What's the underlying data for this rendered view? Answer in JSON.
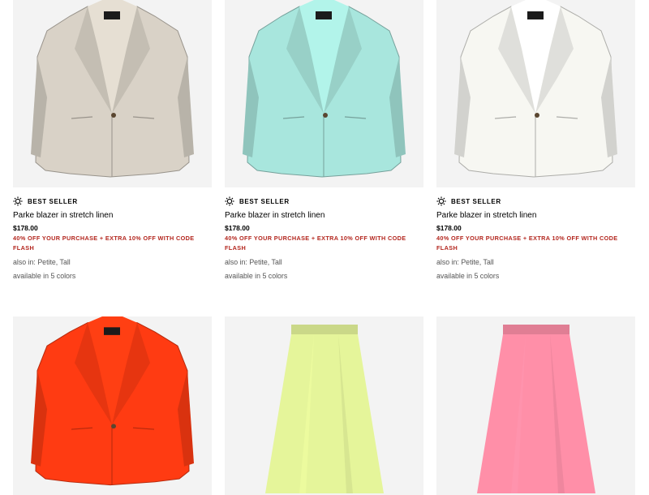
{
  "products": [
    {
      "badge": "BEST SELLER",
      "name": "Parke blazer in stretch linen",
      "price": "$178.00",
      "promo": "40% OFF YOUR PURCHASE + EXTRA 10% OFF WITH CODE FLASH",
      "also_in": "also in: Petite, Tall",
      "colors": "available in 5 colors",
      "color": "#d9d2c7",
      "kind": "blazer"
    },
    {
      "badge": "BEST SELLER",
      "name": "Parke blazer in stretch linen",
      "price": "$178.00",
      "promo": "40% OFF YOUR PURCHASE + EXTRA 10% OFF WITH CODE FLASH",
      "also_in": "also in: Petite, Tall",
      "colors": "available in 5 colors",
      "color": "#a8e6dd",
      "kind": "blazer"
    },
    {
      "badge": "BEST SELLER",
      "name": "Parke blazer in stretch linen",
      "price": "$178.00",
      "promo": "40% OFF YOUR PURCHASE + EXTRA 10% OFF WITH CODE FLASH",
      "also_in": "also in: Petite, Tall",
      "colors": "available in 5 colors",
      "color": "#f7f7f2",
      "kind": "blazer"
    },
    {
      "color": "#ff3b12",
      "kind": "blazer"
    },
    {
      "color": "#e5f59a",
      "kind": "skirt"
    },
    {
      "color": "#ff8fa8",
      "kind": "skirt"
    }
  ]
}
